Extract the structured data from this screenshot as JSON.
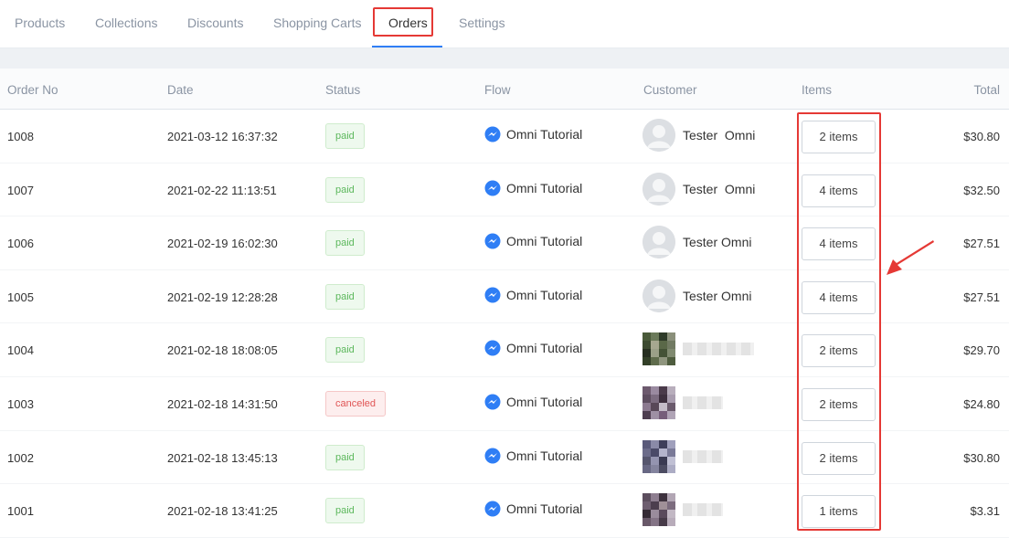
{
  "tabs": [
    {
      "label": "Products"
    },
    {
      "label": "Collections"
    },
    {
      "label": "Discounts"
    },
    {
      "label": "Shopping Carts"
    },
    {
      "label": "Orders",
      "active": true
    },
    {
      "label": "Settings"
    }
  ],
  "table": {
    "headers": {
      "order_no": "Order No",
      "date": "Date",
      "status": "Status",
      "flow": "Flow",
      "customer": "Customer",
      "items": "Items",
      "total": "Total"
    },
    "rows": [
      {
        "order_no": "1008",
        "date": "2021-03-12 16:37:32",
        "status": "paid",
        "flow": "Omni Tutorial",
        "customer": "Tester  Omni",
        "items": "2 items",
        "total": "$30.80"
      },
      {
        "order_no": "1007",
        "date": "2021-02-22 11:13:51",
        "status": "paid",
        "flow": "Omni Tutorial",
        "customer": "Tester  Omni",
        "items": "4 items",
        "total": "$32.50"
      },
      {
        "order_no": "1006",
        "date": "2021-02-19 16:02:30",
        "status": "paid",
        "flow": "Omni Tutorial",
        "customer": "Tester Omni",
        "items": "4 items",
        "total": "$27.51"
      },
      {
        "order_no": "1005",
        "date": "2021-02-19 12:28:28",
        "status": "paid",
        "flow": "Omni Tutorial",
        "customer": "Tester Omni",
        "items": "4 items",
        "total": "$27.51"
      },
      {
        "order_no": "1004",
        "date": "2021-02-18 18:08:05",
        "status": "paid",
        "flow": "Omni Tutorial",
        "customer": "",
        "items": "2 items",
        "total": "$29.70"
      },
      {
        "order_no": "1003",
        "date": "2021-02-18 14:31:50",
        "status": "canceled",
        "flow": "Omni Tutorial",
        "customer": "",
        "items": "2 items",
        "total": "$24.80"
      },
      {
        "order_no": "1002",
        "date": "2021-02-18 13:45:13",
        "status": "paid",
        "flow": "Omni Tutorial",
        "customer": "",
        "items": "2 items",
        "total": "$30.80"
      },
      {
        "order_no": "1001",
        "date": "2021-02-18 13:41:25",
        "status": "paid",
        "flow": "Omni Tutorial",
        "customer": "",
        "items": "1 items",
        "total": "$3.31"
      }
    ]
  },
  "colors": {
    "accent": "#2f7ef5",
    "highlight": "#e53935",
    "paid": "#5cb85c",
    "canceled": "#e05555",
    "messenger": "#2f7ef5"
  },
  "icons": {
    "flow": "messenger-icon",
    "avatar": "default-avatar-icon",
    "annotation": "red-arrow-icon"
  }
}
